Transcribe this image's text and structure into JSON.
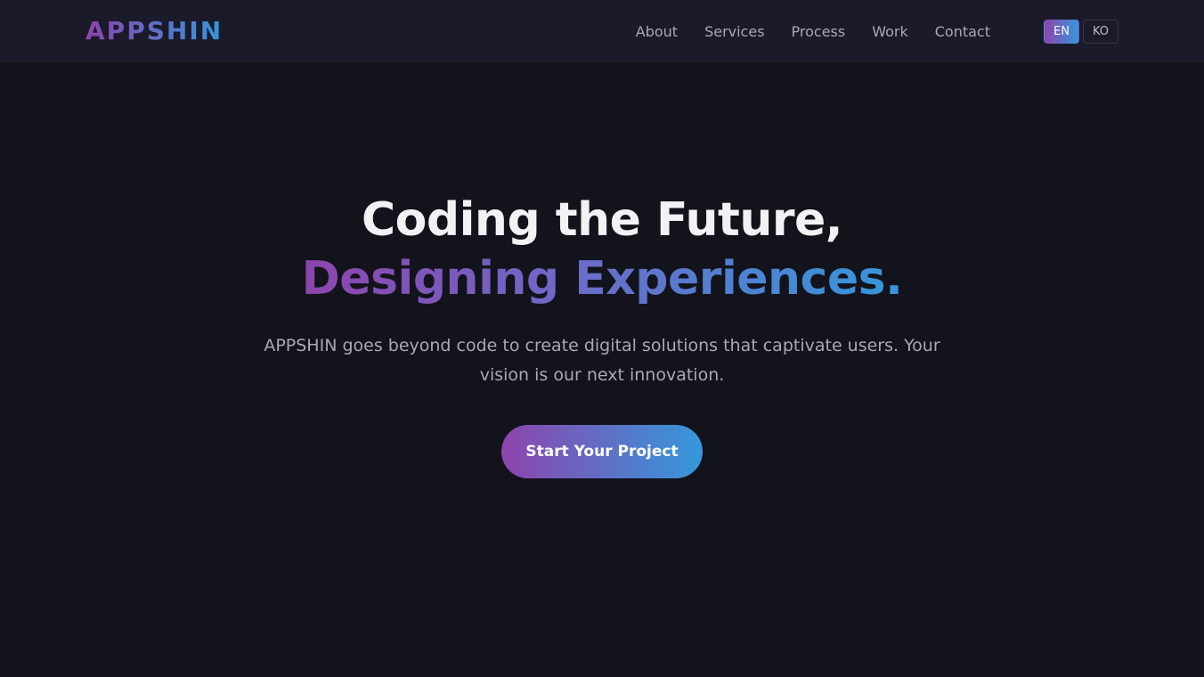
{
  "brand": {
    "logo_text": "APPSHIN",
    "gradient_start": "#8e44ad",
    "gradient_end": "#3498db"
  },
  "nav": {
    "links": [
      {
        "label": "About"
      },
      {
        "label": "Services"
      },
      {
        "label": "Process"
      },
      {
        "label": "Work"
      },
      {
        "label": "Contact"
      }
    ]
  },
  "language": {
    "options": [
      {
        "label": "EN",
        "active": true
      },
      {
        "label": "KO",
        "active": false
      }
    ]
  },
  "hero": {
    "title_line1": "Coding the Future,",
    "title_line2": "Designing Experiences.",
    "subtitle": "APPSHIN goes beyond code to create digital solutions that captivate users. Your vision is our next innovation.",
    "cta_label": "Start Your Project"
  },
  "colors": {
    "background": "#13131c",
    "navbar": "#1a1a2b",
    "text_primary": "#f2f2f5",
    "text_muted": "#a8a8b8"
  }
}
